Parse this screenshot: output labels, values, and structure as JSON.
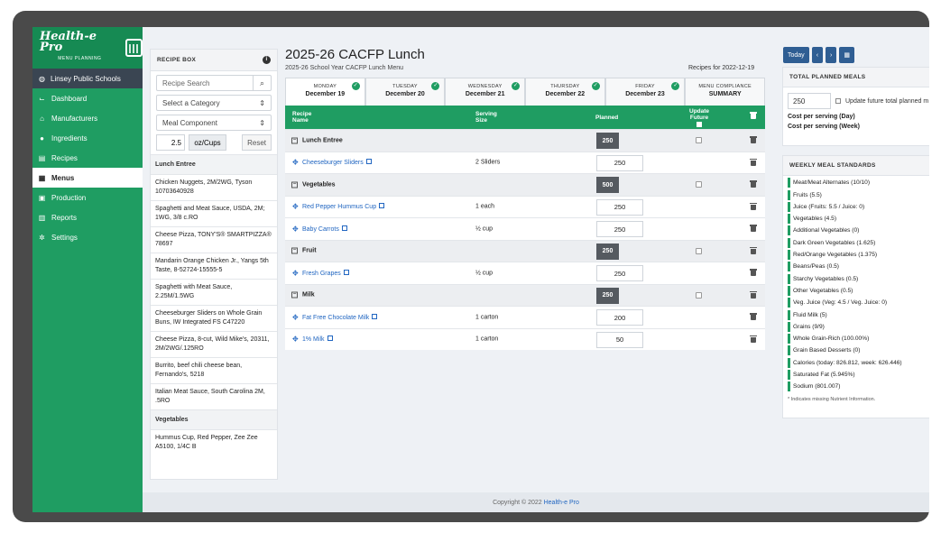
{
  "sidebar": {
    "logo": "Health-e Pro",
    "logo_sub": "MENU PLANNING",
    "org": "Linsey Public Schools",
    "items": [
      {
        "label": "Dashboard",
        "icon": "chart-icon"
      },
      {
        "label": "Manufacturers",
        "icon": "factory-icon"
      },
      {
        "label": "Ingredients",
        "icon": "apple-icon"
      },
      {
        "label": "Recipes",
        "icon": "document-icon"
      },
      {
        "label": "Menus",
        "icon": "calendar-icon"
      },
      {
        "label": "Production",
        "icon": "clipboard-icon"
      },
      {
        "label": "Reports",
        "icon": "table-icon"
      },
      {
        "label": "Settings",
        "icon": "gear-icon"
      }
    ],
    "active": "Menus"
  },
  "recipe_box": {
    "title": "RECIPE BOX",
    "search_placeholder": "Recipe Search",
    "category": "Select a Category",
    "component": "Meal Component",
    "amount": "2.5",
    "unit": "oz/Cups",
    "reset": "Reset",
    "groups": [
      {
        "name": "Lunch Entree",
        "items": [
          "Chicken Nuggets, 2M/2WG, Tyson 10703640928",
          "Spaghetti and Meat Sauce, USDA, 2M; 1WG, 3/8 c.RO",
          "Cheese Pizza, TONY'S® SMARTPIZZA® 78697",
          "Mandarin Orange Chicken Jr., Yangs 5th Taste, 8-52724-15555-5",
          "Spaghetti with Meat Sauce, 2.25M/1.5WG",
          "Cheeseburger Sliders on Whole Grain Buns, IW Integrated FS C47220",
          "Cheese Pizza, 8-cut, Wild Mike's, 20311, 2M/2WG/.125RO",
          "Burrito, beef chili cheese bean, Fernando's, 5218",
          "Italian Meat Sauce, South Carolina 2M, .5RO"
        ]
      },
      {
        "name": "Vegetables",
        "items": [
          "Hummus Cup, Red Pepper, Zee Zee A5100, 1/4C B"
        ]
      }
    ]
  },
  "main": {
    "title": "2025-26 CACFP Lunch",
    "subtitle": "2025-26 School Year CACFP Lunch Menu",
    "recipes_for": "Recipes for 2022-12-19",
    "days": [
      {
        "dow": "MONDAY",
        "date": "December 19",
        "checked": true
      },
      {
        "dow": "TUESDAY",
        "date": "December 20",
        "checked": true
      },
      {
        "dow": "WEDNESDAY",
        "date": "December 21",
        "checked": true
      },
      {
        "dow": "THURSDAY",
        "date": "December 22",
        "checked": true
      },
      {
        "dow": "FRIDAY",
        "date": "December 23",
        "checked": true
      },
      {
        "dow": "MENU COMPLIANCE",
        "date": "SUMMARY",
        "checked": false
      }
    ],
    "columns": {
      "recipe1": "Recipe",
      "recipe2": "Name",
      "serving1": "Serving",
      "serving2": "Size",
      "planned": "Planned",
      "update1": "Update",
      "update2": "Future"
    },
    "rows": [
      {
        "type": "cat",
        "name": "Lunch Entree",
        "planned": "250"
      },
      {
        "type": "item",
        "name": "Cheeseburger Sliders",
        "serving": "2 Sliders",
        "planned": "250"
      },
      {
        "type": "cat",
        "name": "Vegetables",
        "planned": "500"
      },
      {
        "type": "item",
        "name": "Red Pepper Hummus Cup",
        "serving": "1 each",
        "planned": "250"
      },
      {
        "type": "item",
        "name": "Baby Carrots",
        "serving": "½ cup",
        "planned": "250"
      },
      {
        "type": "cat",
        "name": "Fruit",
        "planned": "250"
      },
      {
        "type": "item",
        "name": "Fresh Grapes",
        "serving": "½ cup",
        "planned": "250"
      },
      {
        "type": "cat",
        "name": "Milk",
        "planned": "250"
      },
      {
        "type": "item",
        "name": "Fat Free Chocolate Milk",
        "serving": "1 carton",
        "planned": "200"
      },
      {
        "type": "item",
        "name": "1% Milk",
        "serving": "1 carton",
        "planned": "50"
      }
    ]
  },
  "right": {
    "today": "Today",
    "prev": "‹",
    "next": "›",
    "total_title": "TOTAL PLANNED MEALS",
    "total_value": "250",
    "update_label": "Update future total planned m",
    "cost_day": "Cost per serving (Day)",
    "cost_week": "Cost per serving (Week)",
    "standards_title": "WEEKLY MEAL STANDARDS",
    "standards": [
      "Meat/Meat Alternates (10/10)",
      "Fruits (5.5)",
      "Juice (Fruits: 5.5 / Juice: 0)",
      "Vegetables (4.5)",
      "Additional Vegetables (0)",
      "Dark Green Vegetables (1.625)",
      "Red/Orange Vegetables (1.375)",
      "Beans/Peas (0.5)",
      "Starchy Vegetables (0.5)",
      "Other Vegetables (0.5)",
      "Veg. Juice (Veg: 4.5 / Veg. Juice: 0)",
      "Fluid Milk (5)",
      "Grains (9/9)",
      "Whole Grain-Rich (100.00%)",
      "Grain Based Desserts (0)",
      "Calories (today: 826.812, week: 626.446)",
      "Saturated Fat (5.945%)",
      "Sodium (801.007)"
    ],
    "note": "* Indicates missing Nutrient Information."
  },
  "footer": {
    "text": "Copyright © 2022",
    "link": "Health-e Pro"
  },
  "colors": {
    "brand_green": "#1f9d62",
    "dark_badge": "#555a60",
    "link_blue": "#2166c1",
    "nav_button": "#2f5e93"
  }
}
